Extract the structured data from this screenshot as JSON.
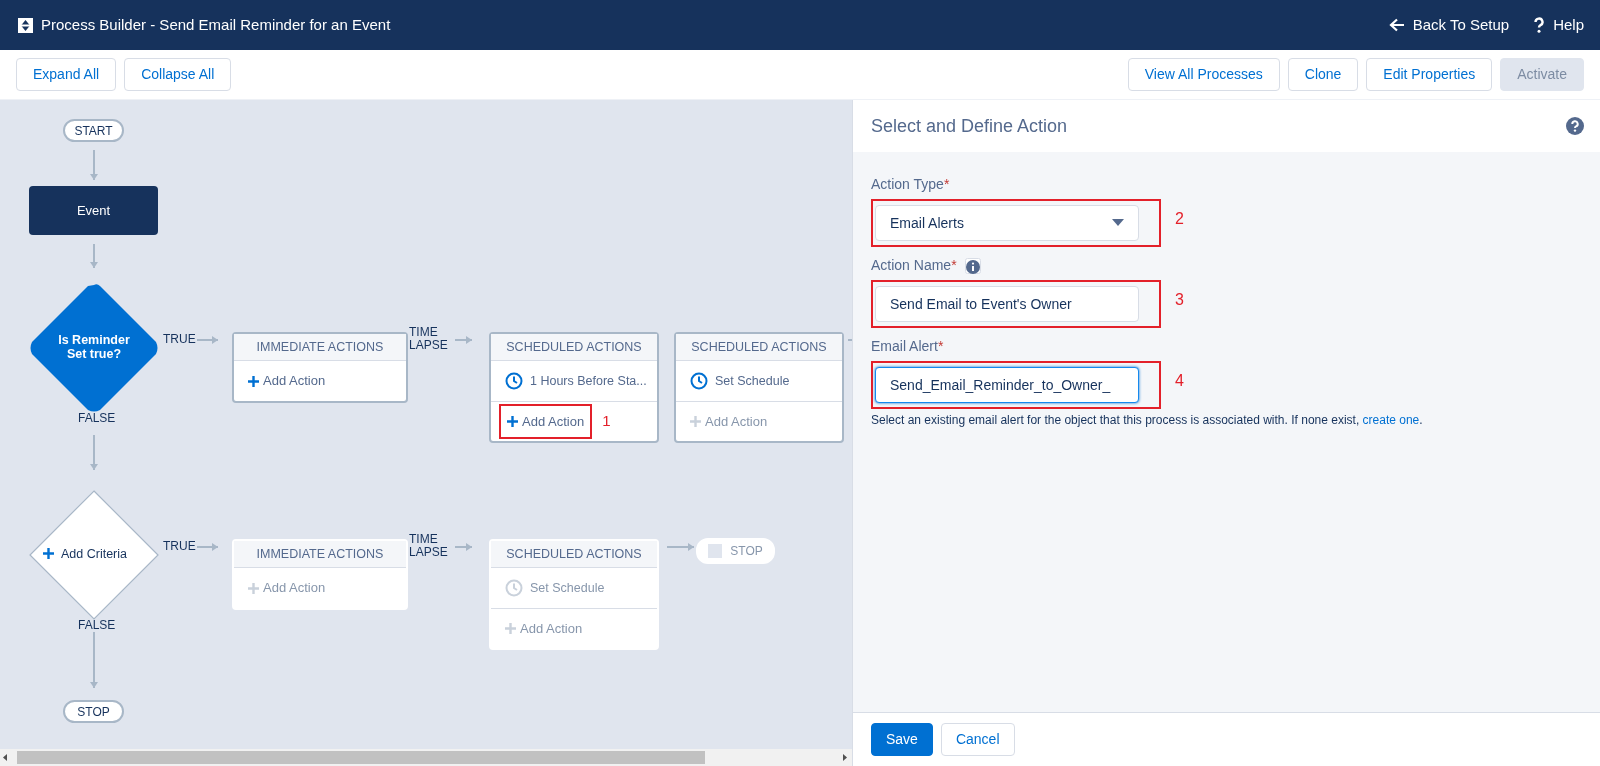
{
  "header": {
    "title": "Process Builder - Send Email Reminder for an Event",
    "links": [
      {
        "label": "Back To Setup"
      },
      {
        "label": "Help"
      }
    ]
  },
  "toolbar": {
    "left": [
      {
        "label": "Expand All",
        "disabled": false
      },
      {
        "label": "Collapse All",
        "disabled": false
      }
    ],
    "right": [
      {
        "label": "View All Processes",
        "disabled": false
      },
      {
        "label": "Clone",
        "disabled": false
      },
      {
        "label": "Edit Properties",
        "disabled": false
      },
      {
        "label": "Activate",
        "disabled": true
      }
    ]
  },
  "diagram": {
    "start": "START",
    "object": "Event",
    "stop": "STOP",
    "criteria": [
      {
        "kind": "defined",
        "label": "Is Reminder Set true?",
        "true_label": "TRUE",
        "false_label": "FALSE",
        "time_lapse_label": "TIME LAPSE",
        "immediate": {
          "header": "IMMEDIATE ACTIONS",
          "add_action": {
            "label": "Add Action",
            "disabled": false,
            "highlighted": false
          }
        },
        "scheduled": [
          {
            "header": "SCHEDULED ACTIONS",
            "schedule": {
              "label": "1 Hours Before Sta...",
              "disabled": false
            },
            "add_action": {
              "label": "Add Action",
              "disabled": false,
              "highlighted": true,
              "annotation": "1"
            }
          },
          {
            "header": "SCHEDULED ACTIONS",
            "schedule": {
              "label": "Set Schedule",
              "disabled": false
            },
            "add_action": {
              "label": "Add Action",
              "disabled": true,
              "highlighted": false
            }
          }
        ]
      },
      {
        "kind": "add",
        "label": "Add Criteria",
        "true_label": "TRUE",
        "false_label": "FALSE",
        "time_lapse_label": "TIME LAPSE",
        "immediate": {
          "header": "IMMEDIATE ACTIONS",
          "add_action": {
            "label": "Add Action",
            "disabled": true,
            "highlighted": false
          }
        },
        "scheduled": [
          {
            "header": "SCHEDULED ACTIONS",
            "schedule": {
              "label": "Set Schedule",
              "disabled": true
            },
            "add_action": {
              "label": "Add Action",
              "disabled": true,
              "highlighted": false
            }
          }
        ],
        "end_stop": {
          "label": "STOP",
          "disabled": true
        }
      }
    ]
  },
  "panel": {
    "title": "Select and Define Action",
    "fields": [
      {
        "kind": "select",
        "label": "Action Type",
        "required_mark": "*",
        "value": "Email Alerts",
        "annotation": "2"
      },
      {
        "kind": "text",
        "label": "Action Name",
        "required_mark": "*",
        "info": true,
        "value": "Send Email to Event's Owner",
        "annotation": "3"
      },
      {
        "kind": "text",
        "label": "Email Alert",
        "required_mark": "*",
        "value": "Send_Email_Reminder_to_Owner_",
        "focused": true,
        "annotation": "4"
      }
    ],
    "help": {
      "before": "Select an existing email alert for the object that this process is associated with. If none exist, ",
      "link": "create one",
      "after": "."
    },
    "buttons": [
      {
        "label": "Save",
        "kind": "primary"
      },
      {
        "label": "Cancel",
        "kind": "neutral"
      }
    ]
  }
}
